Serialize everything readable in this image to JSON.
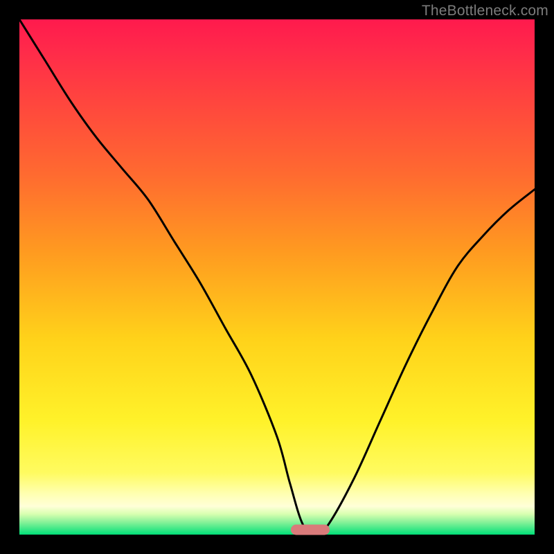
{
  "watermark": "TheBottleneck.com",
  "colors": {
    "frame": "#000000",
    "curve_stroke": "#000000",
    "marker_fill": "#d97a7a"
  },
  "chart_data": {
    "type": "line",
    "title": "",
    "xlabel": "",
    "ylabel": "",
    "xlim": [
      0,
      1
    ],
    "ylim": [
      0,
      1
    ],
    "x": [
      0.0,
      0.05,
      0.1,
      0.15,
      0.2,
      0.25,
      0.3,
      0.35,
      0.4,
      0.45,
      0.5,
      0.525,
      0.55,
      0.575,
      0.6,
      0.65,
      0.7,
      0.75,
      0.8,
      0.85,
      0.9,
      0.95,
      1.0
    ],
    "values": [
      1.0,
      0.92,
      0.84,
      0.77,
      0.71,
      0.65,
      0.57,
      0.49,
      0.4,
      0.31,
      0.19,
      0.1,
      0.02,
      0.0,
      0.02,
      0.11,
      0.22,
      0.33,
      0.43,
      0.52,
      0.58,
      0.63,
      0.67
    ],
    "gradient_stops": [
      {
        "pos": 0.0,
        "color": "#ff1a4d"
      },
      {
        "pos": 0.3,
        "color": "#ff6a30"
      },
      {
        "pos": 0.62,
        "color": "#ffd21a"
      },
      {
        "pos": 0.88,
        "color": "#fffb60"
      },
      {
        "pos": 1.0,
        "color": "#00e078"
      }
    ],
    "marker": {
      "x": 0.565,
      "y": 0.0
    }
  }
}
